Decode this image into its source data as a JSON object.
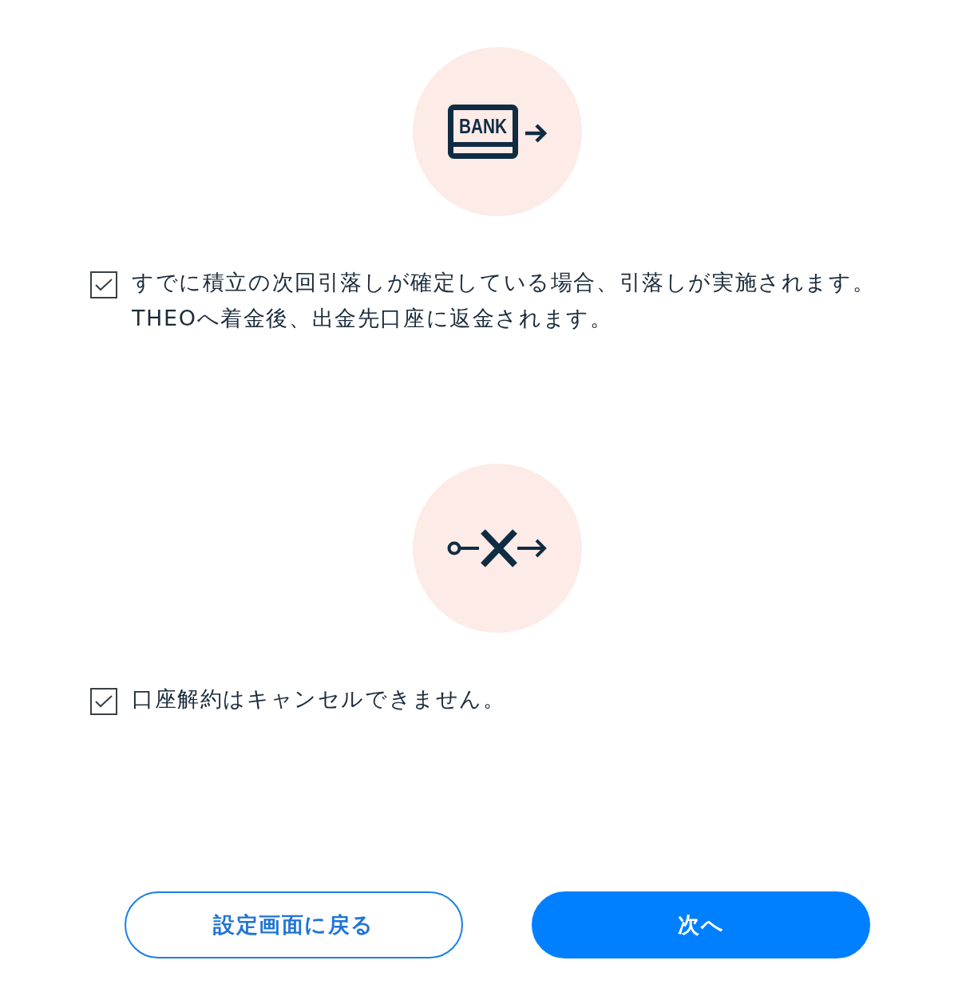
{
  "sections": [
    {
      "icon": {
        "kind": "bank",
        "label": "BANK"
      },
      "checked": true,
      "lines": [
        "すでに積立の次回引落しが確定している場合、引落しが実施されます。",
        "THEOへ着金後、出金先口座に返金されます。"
      ]
    },
    {
      "icon": {
        "kind": "blocked"
      },
      "checked": true,
      "lines": [
        "口座解約はキャンセルできません。"
      ]
    }
  ],
  "buttons": [
    {
      "kind": "outline",
      "label": "設定画面に戻る"
    },
    {
      "kind": "primary",
      "label": "次へ"
    }
  ]
}
